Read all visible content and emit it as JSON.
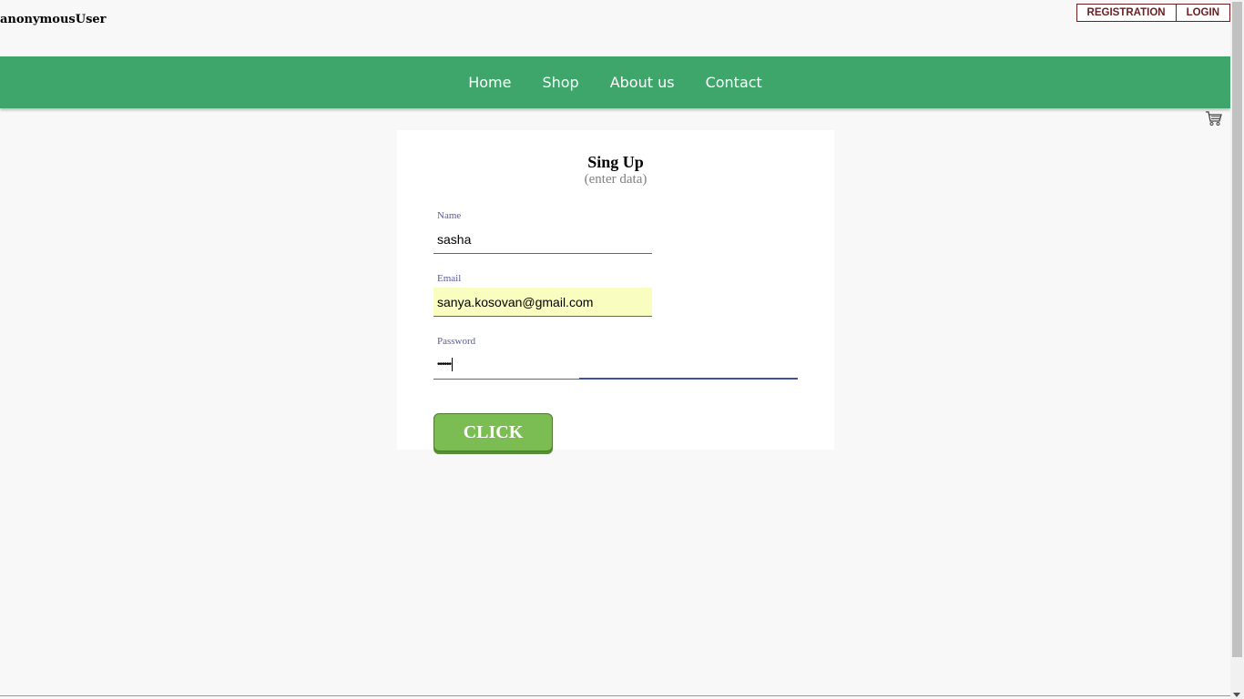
{
  "header": {
    "username": "anonymousUser",
    "registration_label": "REGISTRATION",
    "login_label": "LOGIN"
  },
  "nav": {
    "items": [
      {
        "label": "Home"
      },
      {
        "label": "Shop"
      },
      {
        "label": "About us"
      },
      {
        "label": "Contact"
      }
    ]
  },
  "cart": {
    "icon": "cart-icon"
  },
  "form": {
    "title": "Sing Up",
    "subtitle": "(enter data)",
    "name_label": "Name",
    "name_value": "sasha",
    "email_label": "Email",
    "email_value": "sanya.kosovan@gmail.com",
    "password_label": "Password",
    "password_value": "••••••",
    "submit_label": "CLICK"
  },
  "colors": {
    "nav_bg": "#3fa66b",
    "button_bg": "#7cbd53",
    "auth_border": "#6d1d1d",
    "autofill_bg": "#fafdc0",
    "focus_line": "#3f51a0"
  }
}
